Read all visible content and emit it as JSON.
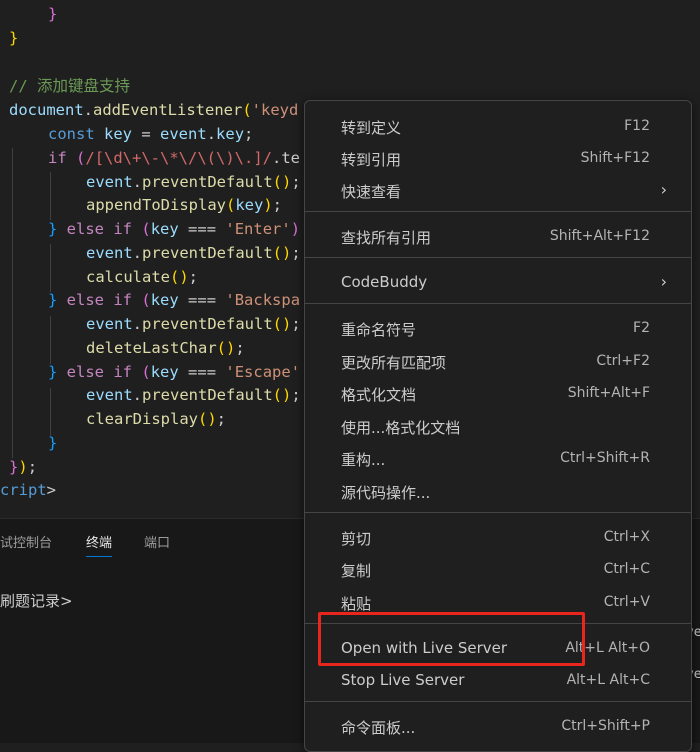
{
  "code": {
    "line0": "}",
    "line1": "}",
    "comment": "// 添加键盘支持",
    "l3_obj": "document",
    "l3_dot": ".",
    "l3_fn": "addEventListener",
    "l3_paren": "(",
    "l3_str": "'keyd",
    "l4_kw": "const",
    "l4_var": "key",
    "l4_eq": " = ",
    "l4_obj": "event",
    "l4_dot": ".",
    "l4_prop": "key",
    "l4_semi": ";",
    "l5_kw": "if",
    "l5_paren": "(",
    "l5_regex": "/[\\d\\+\\-\\*\\/\\(\\)\\.]/",
    "l5_rest": ".te",
    "l6_obj": "event",
    "l6_dot": ".",
    "l6_fn": "preventDefault",
    "l6_call": "()",
    "l6_semi": ";",
    "l7_fn": "appendToDisplay",
    "l7_open": "(",
    "l7_var": "key",
    "l7_close": ")",
    "l7_semi": ";",
    "l8_brace": "}",
    "l8_else": " else ",
    "l8_if": "if",
    "l8_open": "(",
    "l8_var": "key",
    "l8_eq": " === ",
    "l8_str": "'Enter'",
    "l8_close": ")",
    "l9_obj": "event",
    "l9_dot": ".",
    "l9_fn": "preventDefault",
    "l9_call": "()",
    "l9_semi": ";",
    "l10_fn": "calculate",
    "l10_call": "()",
    "l10_semi": ";",
    "l11_brace": "}",
    "l11_else": " else ",
    "l11_if": "if",
    "l11_open": "(",
    "l11_var": "key",
    "l11_eq": " === ",
    "l11_str": "'Backspa",
    "l12_obj": "event",
    "l12_dot": ".",
    "l12_fn": "preventDefault",
    "l12_call": "()",
    "l12_semi": ";",
    "l13_fn": "deleteLastChar",
    "l13_call": "()",
    "l13_semi": ";",
    "l14_brace": "}",
    "l14_else": " else ",
    "l14_if": "if",
    "l14_open": "(",
    "l14_var": "key",
    "l14_eq": " === ",
    "l14_str": "'Escape'",
    "l15_obj": "event",
    "l15_dot": ".",
    "l15_fn": "preventDefault",
    "l15_call": "()",
    "l15_semi": ";",
    "l16_fn": "clearDisplay",
    "l16_call": "()",
    "l16_semi": ";",
    "l17": "}",
    "l18_brace": "}",
    "l18_paren": ")",
    "l18_semi": ";",
    "l19_tag": "cript",
    "l19_gt": ">"
  },
  "panel": {
    "tabs": [
      "试控制台",
      "终端",
      "端口"
    ],
    "terminal_prompt": "刷题记录>",
    "edge_labels": [
      "ve",
      "ve"
    ]
  },
  "context_menu": {
    "items": [
      {
        "label": "转到定义",
        "shortcut": "F12"
      },
      {
        "label": "转到引用",
        "shortcut": "Shift+F12"
      },
      {
        "label": "快速查看",
        "submenu": "›"
      },
      {
        "label": "查找所有引用",
        "shortcut": "Shift+Alt+F12"
      },
      {
        "label": "CodeBuddy",
        "submenu": "›"
      },
      {
        "label": "重命名符号",
        "shortcut": "F2"
      },
      {
        "label": "更改所有匹配项",
        "shortcut": "Ctrl+F2"
      },
      {
        "label": "格式化文档",
        "shortcut": "Shift+Alt+F"
      },
      {
        "label": "使用...格式化文档",
        "shortcut": ""
      },
      {
        "label": "重构...",
        "shortcut": "Ctrl+Shift+R"
      },
      {
        "label": "源代码操作...",
        "shortcut": ""
      },
      {
        "label": "剪切",
        "shortcut": "Ctrl+X"
      },
      {
        "label": "复制",
        "shortcut": "Ctrl+C"
      },
      {
        "label": "粘贴",
        "shortcut": "Ctrl+V"
      },
      {
        "label": "Open with Live Server",
        "shortcut": "Alt+L Alt+O"
      },
      {
        "label": "Stop Live Server",
        "shortcut": "Alt+L Alt+C"
      },
      {
        "label": "命令面板...",
        "shortcut": "Ctrl+Shift+P"
      }
    ]
  },
  "colors": {
    "highlight_box": "#e8261e",
    "background": "#1f1f1f",
    "accent": "#0078d4"
  }
}
